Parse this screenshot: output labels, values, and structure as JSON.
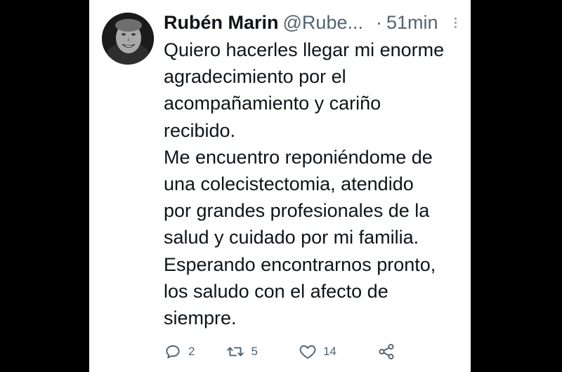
{
  "tweet": {
    "author_name": "Rubén Marin",
    "author_handle": "@Rube...",
    "separator": "·",
    "time": "51min",
    "lines": [
      "Quiero hacerles llegar mi enorme",
      "agradecimiento por el",
      "acompañamiento y cariño",
      "recibido.",
      "Me encuentro reponiéndome de",
      "una colecistectomia, atendido",
      "por grandes profesionales de la",
      "salud y cuidado por mi familia.",
      "Esperando encontrarnos pronto,",
      "los saludo con el afecto de",
      "siempre."
    ],
    "replies": "2",
    "retweets": "5",
    "likes": "14"
  },
  "icons": {
    "avatar": "avatar-photo",
    "more": "more-icon",
    "reply": "reply-icon",
    "retweet": "retweet-icon",
    "like": "like-icon",
    "share": "share-icon"
  },
  "colors": {
    "background": "#000000",
    "card": "#ffffff",
    "text": "#0f1419",
    "secondary": "#536471"
  }
}
